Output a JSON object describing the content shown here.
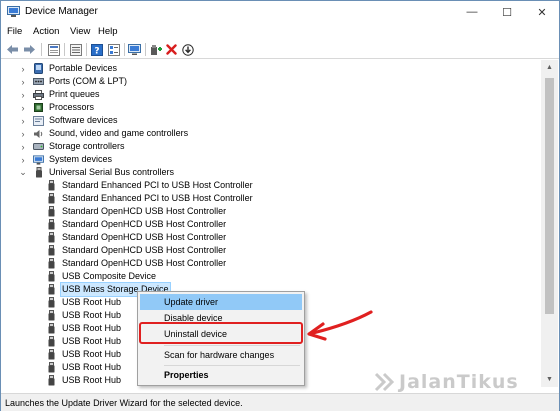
{
  "window": {
    "title": "Device Manager",
    "controls": {
      "minimize": "—",
      "maximize": "☐",
      "close": "✕"
    }
  },
  "menubar": {
    "items": [
      "File",
      "Action",
      "View",
      "Help"
    ]
  },
  "toolbar": {
    "buttons": [
      "back-arrow-icon",
      "forward-arrow-icon",
      "properties-sheet-icon",
      "refresh-list-icon",
      "help-icon",
      "details-icon",
      "monitor-icon",
      "add-driver-icon",
      "remove-device-icon",
      "download-driver-icon"
    ]
  },
  "tree": {
    "categories": [
      {
        "label": "Portable Devices",
        "icon": "portable-device-icon",
        "expanded": false
      },
      {
        "label": "Ports (COM & LPT)",
        "icon": "port-icon",
        "expanded": false
      },
      {
        "label": "Print queues",
        "icon": "printer-icon",
        "expanded": false
      },
      {
        "label": "Processors",
        "icon": "cpu-icon",
        "expanded": false
      },
      {
        "label": "Software devices",
        "icon": "software-device-icon",
        "expanded": false
      },
      {
        "label": "Sound, video and game controllers",
        "icon": "speaker-icon",
        "expanded": false
      },
      {
        "label": "Storage controllers",
        "icon": "storage-icon",
        "expanded": false
      },
      {
        "label": "System devices",
        "icon": "system-device-icon",
        "expanded": false
      },
      {
        "label": "Universal Serial Bus controllers",
        "icon": "usb-icon",
        "expanded": true
      }
    ],
    "usb_children": [
      "Standard Enhanced PCI to USB Host Controller",
      "Standard Enhanced PCI to USB Host Controller",
      "Standard OpenHCD USB Host Controller",
      "Standard OpenHCD USB Host Controller",
      "Standard OpenHCD USB Host Controller",
      "Standard OpenHCD USB Host Controller",
      "Standard OpenHCD USB Host Controller",
      "USB Composite Device",
      "USB Mass Storage Device",
      "USB Root Hub",
      "USB Root Hub",
      "USB Root Hub",
      "USB Root Hub",
      "USB Root Hub",
      "USB Root Hub",
      "USB Root Hub"
    ],
    "selected_child_index": 8
  },
  "context_menu": {
    "items": [
      {
        "label": "Update driver",
        "hover": true
      },
      {
        "label": "Disable device"
      },
      {
        "label": "Uninstall device",
        "highlighted": true
      },
      {
        "label": "Scan for hardware changes"
      },
      {
        "label": "Properties",
        "bold": true
      }
    ]
  },
  "statusbar": {
    "text": "Launches the Update Driver Wizard for the selected device."
  },
  "watermark": {
    "text": "JalanTikus"
  },
  "colors": {
    "selection": "#cce8ff",
    "menu_hover": "#91c9f7",
    "annotation_red": "#e02020",
    "window_border": "#6a8fb5"
  }
}
